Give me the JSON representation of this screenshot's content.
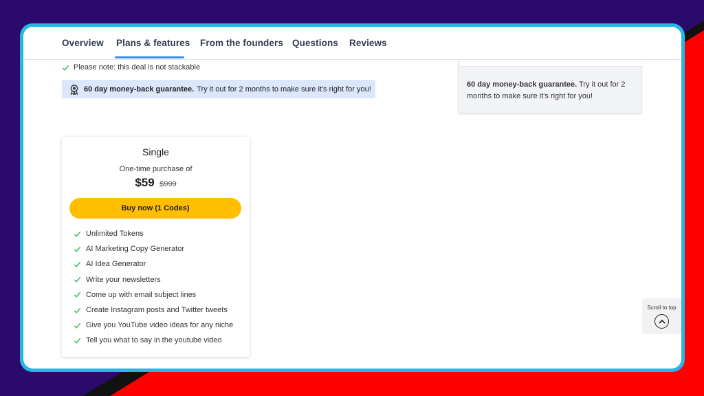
{
  "colors": {
    "background_purple": "#2a0a6b",
    "background_red": "#ff0000",
    "frame_blue": "#29b6e6",
    "tab_underline": "#3d8df5",
    "buy_button": "#ffbf00",
    "check_green": "#2eb85c",
    "guarantee_bg": "#dce7fb"
  },
  "tabs": [
    {
      "label": "Overview",
      "active": false
    },
    {
      "label": "Plans & features",
      "active": true
    },
    {
      "label": "From the founders",
      "active": false
    },
    {
      "label": "Questions",
      "active": false
    },
    {
      "label": "Reviews",
      "active": false
    }
  ],
  "note": {
    "icon": "check-icon",
    "text": "Please note: this deal is not stackable"
  },
  "guarantee": {
    "icon": "ribbon-badge-icon",
    "bold": "60 day money-back guarantee.",
    "text": "Try it out for 2 months to make sure it's right for you!"
  },
  "side_card": {
    "bold": "60 day money-back guarantee.",
    "text": "Try it out for 2 months to make sure it's right for you!"
  },
  "plan": {
    "name": "Single",
    "subtitle": "One-time purchase of",
    "price": "$59",
    "old_price": "$999",
    "button_label": "Buy now (1 Codes)",
    "features": [
      "Unlimited Tokens",
      "AI Marketing Copy Generator",
      "AI Idea Generator",
      "Write your newsletters",
      "Come up with email subject lines",
      "Create Instagram posts and Twitter tweets",
      "Give you YouTube video ideas for any niche",
      "Tell you what to say in the youtube video"
    ]
  },
  "scroll_top": {
    "label": "Scroll to top",
    "icon": "chevron-up-icon"
  }
}
